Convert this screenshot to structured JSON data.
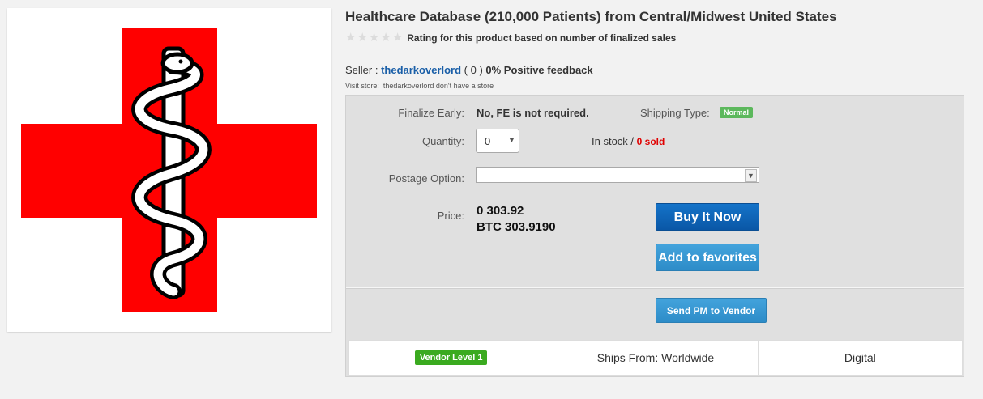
{
  "product": {
    "title": "Healthcare Database (210,000 Patients) from Central/Midwest United States",
    "rating_text": "Rating for this product based on number of finalized sales",
    "stars_filled": 0,
    "stars_total": 5,
    "image_icon": "red-cross-rod-of-asclepius-icon"
  },
  "seller": {
    "label": "Seller : ",
    "name": "thedarkoverlord",
    "count": " ( 0 ) ",
    "feedback": "0% Positive feedback",
    "visit_store_label": "Visit store:",
    "visit_store_text": "thedarkoverlord don't have a store"
  },
  "details": {
    "finalize_label": "Finalize Early:",
    "finalize_value": "No, FE is not required.",
    "shipping_label": "Shipping Type:",
    "shipping_value": "Normal",
    "quantity_label": "Quantity:",
    "quantity_value": "0",
    "stock_text": "In stock / ",
    "sold_text": "0 sold",
    "postage_label": "Postage Option:",
    "postage_value": "",
    "price_label": "Price:",
    "price_main": "0 303.92",
    "price_btc": "BTC 303.9190"
  },
  "buttons": {
    "buy": "Buy It Now",
    "favorites": "Add to favorites",
    "pm": "Send PM to Vendor"
  },
  "footer": {
    "vendor_level": "Vendor Level 1",
    "ships_from": "Ships From: Worldwide",
    "type": "Digital"
  },
  "colors": {
    "cross_red": "#ff0000",
    "seller_link": "#1a5fa8",
    "sold_red": "#e00000",
    "normal_badge": "#5cb85c",
    "vendor_badge": "#3aaa1f",
    "buy_button": "#0a57a6",
    "secondary_button": "#2d8cc8"
  }
}
